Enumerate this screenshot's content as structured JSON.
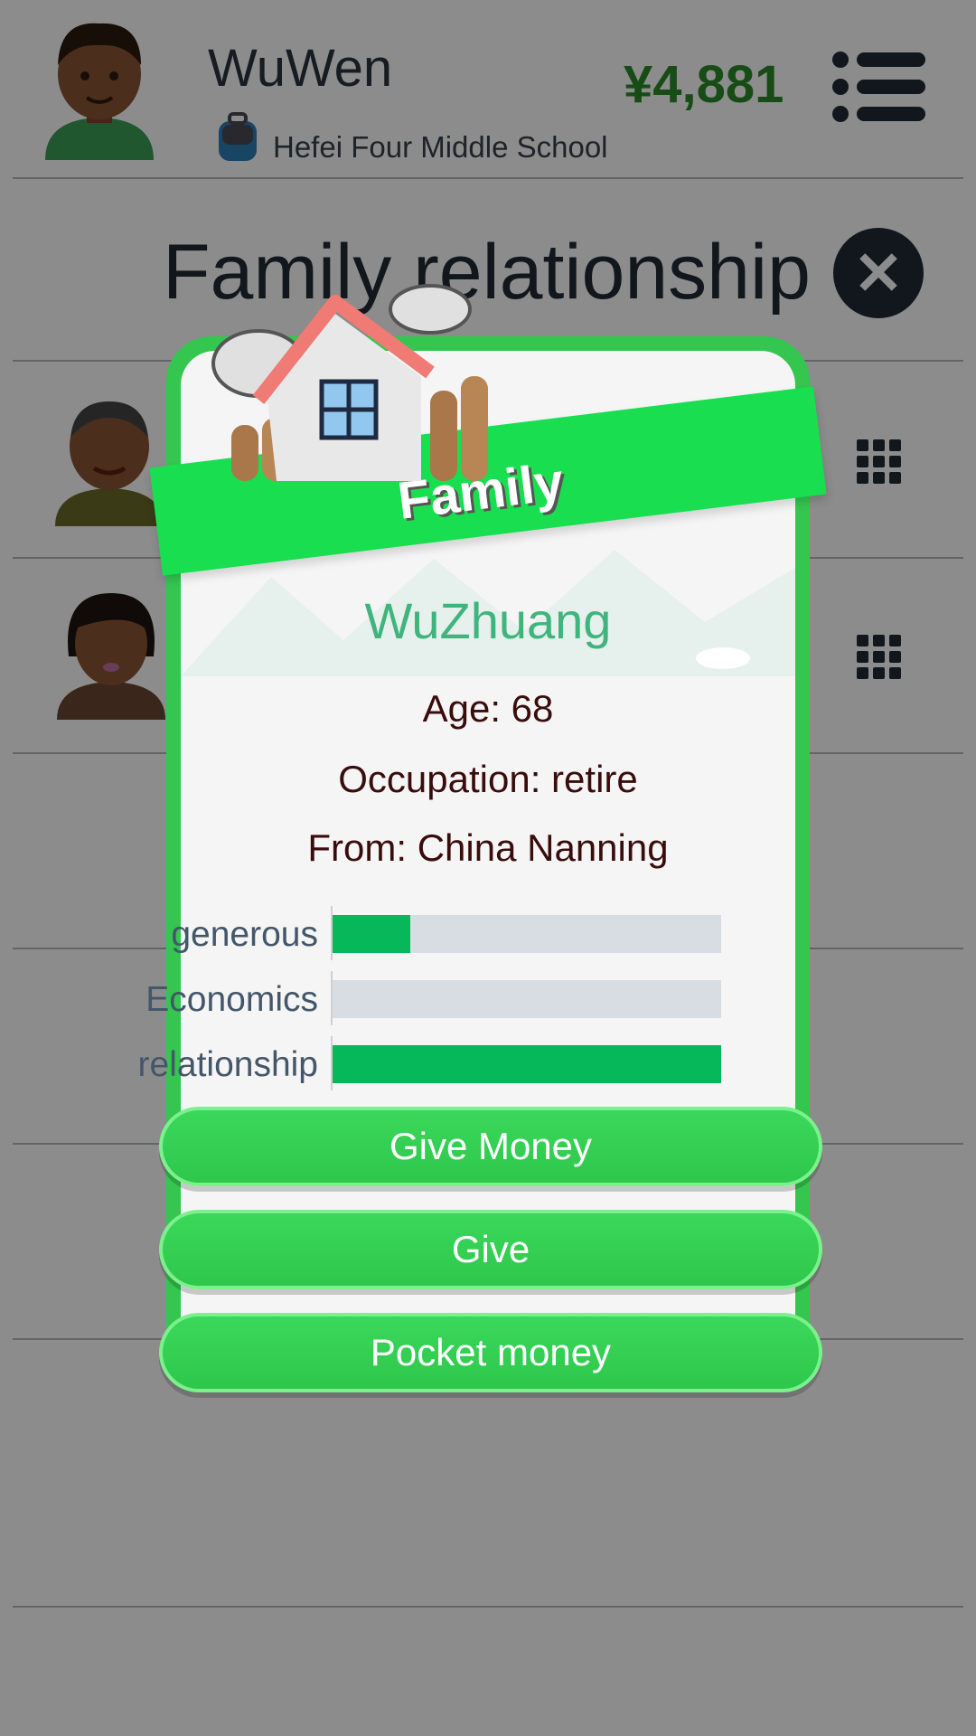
{
  "header": {
    "username": "WuWen",
    "school": "Hefei Four Middle School",
    "money": "¥4,881"
  },
  "page": {
    "title": "Family relationship"
  },
  "modal": {
    "banner": "Family",
    "name": "WuZhuang",
    "age": "Age: 68",
    "occupation": "Occupation: retire",
    "from": "From: China Nanning",
    "stats": [
      {
        "label": "generous",
        "value": 0.2
      },
      {
        "label": "Economics",
        "value": 0.0
      },
      {
        "label": "relationship",
        "value": 1.0
      }
    ],
    "buttons": [
      "Give Money",
      "Give",
      "Pocket money"
    ]
  },
  "colors": {
    "accent_green": "#34c64f",
    "stat_fill": "#06b85a",
    "money": "#2a8a2a"
  }
}
